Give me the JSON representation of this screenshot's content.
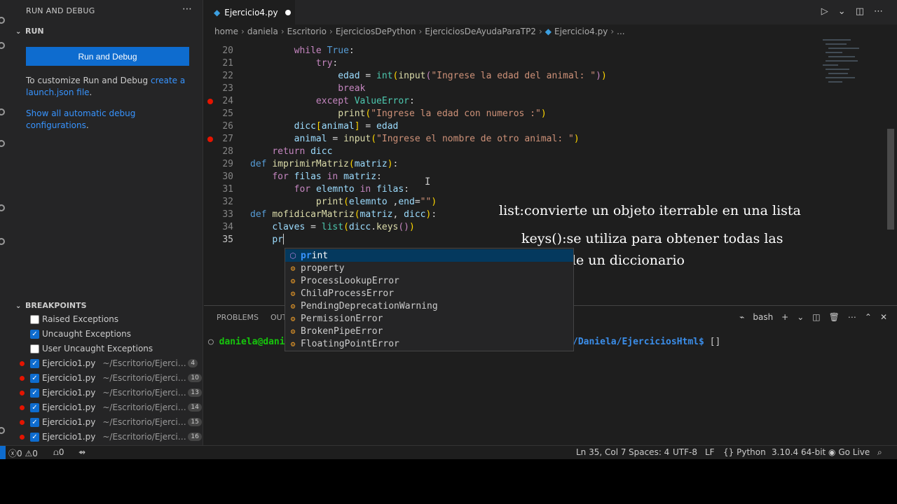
{
  "sidebar": {
    "title": "RUN AND DEBUG",
    "more_icon": "ellipsis-icon",
    "run_section": "RUN",
    "run_button": "Run and Debug",
    "customize_text": "To customize Run and Debug ",
    "customize_link": "create a launch.json file",
    "customize_end": ".",
    "show_all_link": "Show all automatic debug configurations",
    "show_all_end": ".",
    "breakpoints_section": "BREAKPOINTS",
    "exceptions": [
      {
        "label": "Raised Exceptions",
        "checked": false
      },
      {
        "label": "Uncaught Exceptions",
        "checked": true
      },
      {
        "label": "User Uncaught Exceptions",
        "checked": false
      }
    ],
    "breakpoints": [
      {
        "file": "Ejercicio1.py",
        "path": "~/Escritorio/Ejercici...",
        "line": "4"
      },
      {
        "file": "Ejercicio1.py",
        "path": "~/Escritorio/Ejercic...",
        "line": "10"
      },
      {
        "file": "Ejercicio1.py",
        "path": "~/Escritorio/Ejercic...",
        "line": "13"
      },
      {
        "file": "Ejercicio1.py",
        "path": "~/Escritorio/Ejercic...",
        "line": "14"
      },
      {
        "file": "Ejercicio1.py",
        "path": "~/Escritorio/Ejercic...",
        "line": "15"
      },
      {
        "file": "Ejercicio1.py",
        "path": "~/Escritorio/Ejercic...",
        "line": "16"
      }
    ]
  },
  "editor": {
    "tab_label": "Ejercicio4.py",
    "breadcrumb": [
      "home",
      "daniela",
      "Escritorio",
      "EjerciciosDePython",
      "EjerciciosDeAyudaParaTP2",
      "Ejercicio4.py",
      "..."
    ],
    "code_lines": [
      {
        "n": "20",
        "text": "        while True:"
      },
      {
        "n": "21",
        "text": "            try:"
      },
      {
        "n": "22",
        "text": "                edad = int(input(\"Ingrese la edad del animal: \"))"
      },
      {
        "n": "23",
        "text": "                break"
      },
      {
        "n": "24",
        "text": "            except ValueError:"
      },
      {
        "n": "25",
        "text": "                print(\"Ingrese la edad con numeros :\")"
      },
      {
        "n": "26",
        "text": "        dicc[animal] = edad"
      },
      {
        "n": "27",
        "text": "        animal = input(\"Ingrese el nombre de otro animal: \")"
      },
      {
        "n": "28",
        "text": "    return dicc"
      },
      {
        "n": "29",
        "text": "def imprimirMatriz(matriz):"
      },
      {
        "n": "30",
        "text": "    for filas in matriz:"
      },
      {
        "n": "31",
        "text": "        for elemnto in filas:"
      },
      {
        "n": "32",
        "text": "            print(elemnto ,end=\"\")"
      },
      {
        "n": "33",
        "text": "def mofidicarMatriz(matriz, dicc):"
      },
      {
        "n": "34",
        "text": "    claves = list(dicc.keys())"
      },
      {
        "n": "35",
        "text": "    pr"
      }
    ],
    "breakpoint_lines": [
      "24",
      "27"
    ],
    "suggestions": [
      "print",
      "property",
      "ProcessLookupError",
      "ChildProcessError",
      "PendingDeprecationWarning",
      "PermissionError",
      "BrokenPipeError",
      "FloatingPointError"
    ]
  },
  "annotations": [
    "list:convierte un objeto iterrable en una lista",
    "keys():se utiliza para obtener todas las",
    "claves de un diccionario"
  ],
  "panel": {
    "tabs": [
      "PROBLEMS",
      "OUT"
    ],
    "terminal_shell": "bash",
    "terminal_prefix": "daniela@danie",
    "terminal_path": "/Daniela/EjerciciosHtml$",
    "terminal_cursor": "[]"
  },
  "statusbar": {
    "errors": "0",
    "warnings": "0",
    "ports": "0",
    "position": "Ln 35, Col 7",
    "spaces": "Spaces: 4",
    "encoding": "UTF-8",
    "eol": "LF",
    "language": "Python",
    "interpreter": "3.10.4 64-bit",
    "golive": "Go Live"
  },
  "colors": {
    "accent": "#0e6ccf",
    "breakpoint": "#e51400",
    "terminal_green": "#16c60c"
  }
}
